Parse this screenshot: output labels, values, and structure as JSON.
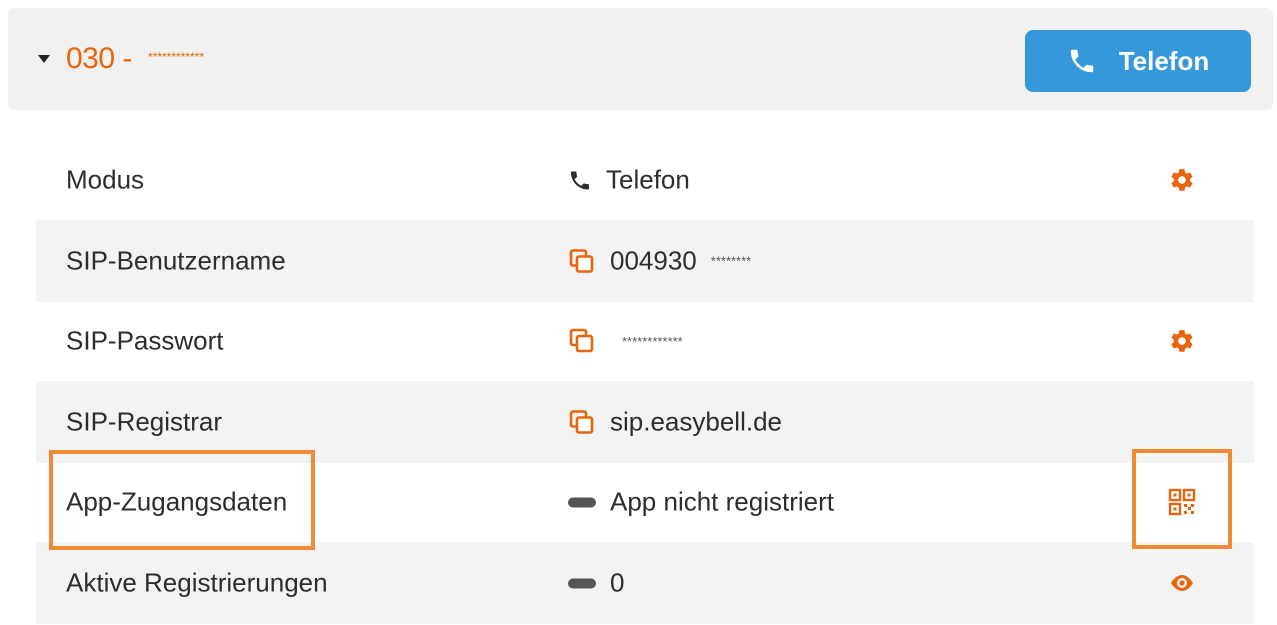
{
  "account": {
    "number_prefix": "030 -",
    "number_masked": "************",
    "mode_button_label": "Telefon"
  },
  "rows": [
    {
      "label": "Modus",
      "value": "Telefon",
      "value_icon": "phone-icon",
      "action_icon": "gear-icon"
    },
    {
      "label": "SIP-Benutzername",
      "value": "004930",
      "value_mask": "********",
      "value_icon": "copy-icon"
    },
    {
      "label": "SIP-Passwort",
      "value": "",
      "value_mask": "************",
      "value_icon": "copy-icon",
      "action_icon": "gear-icon"
    },
    {
      "label": "SIP-Registrar",
      "value": "sip.easybell.de",
      "value_icon": "copy-icon"
    },
    {
      "label": "App-Zugangsdaten",
      "value": "App nicht registriert",
      "value_icon": "status-pill-icon",
      "action_icon": "qr-code-icon"
    },
    {
      "label": "Aktive Registrierungen",
      "value": "0",
      "value_icon": "status-pill-icon",
      "action_icon": "eye-icon"
    }
  ],
  "colors": {
    "accent": "#e8660b",
    "button": "#3498db",
    "highlight": "#f08a34",
    "row_shade": "#f3f3f3",
    "header_bg": "#f1f1f1"
  }
}
